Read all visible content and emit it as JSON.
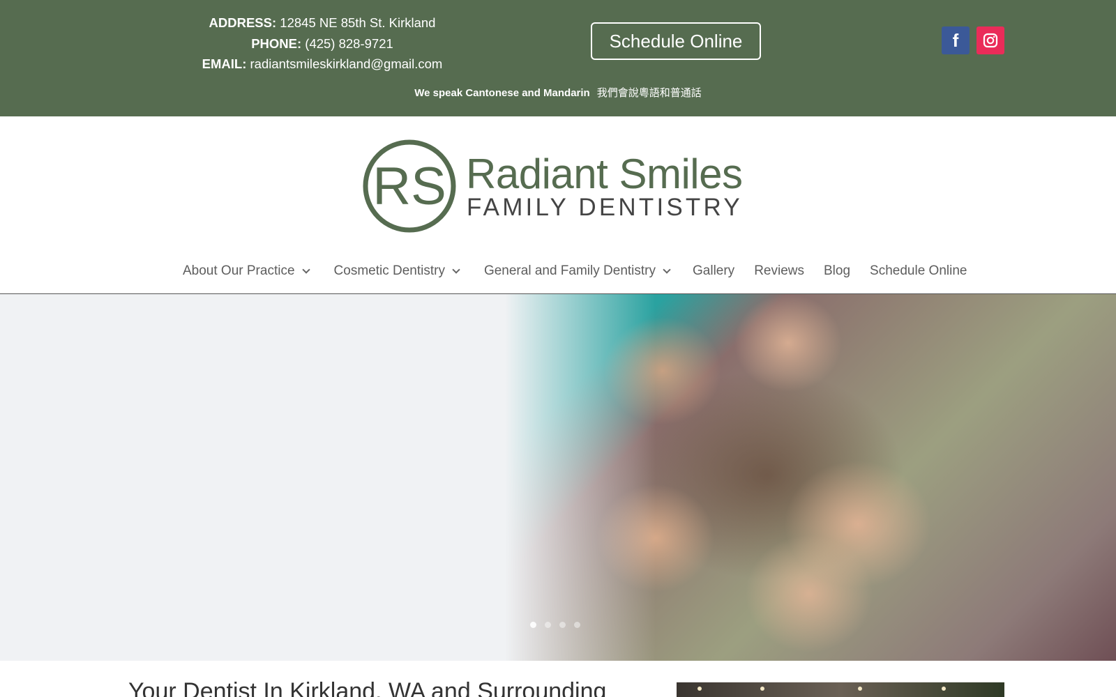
{
  "topbar": {
    "address_label": "ADDRESS:",
    "address": "12845 NE 85th St. Kirkland",
    "phone_label": "PHONE:",
    "phone": "(425) 828-9721",
    "email_label": "EMAIL:",
    "email": "radiantsmileskirkland@gmail.com",
    "schedule_button": "Schedule Online",
    "languages": "We speak Cantonese and Mandarin",
    "languages_cn": "我們會說粵語和普通話",
    "social": [
      {
        "icon": "facebook-icon",
        "color": "#3b5998"
      },
      {
        "icon": "instagram-icon",
        "color": "#ea2c59"
      }
    ],
    "background": "#566c50"
  },
  "logo": {
    "monogram": "RS",
    "name": "Radiant Smiles",
    "subtitle": "FAMILY DENTISTRY",
    "color": "#566c50"
  },
  "nav": {
    "items": [
      {
        "label": "About Our Practice",
        "has_dropdown": true
      },
      {
        "label": "Cosmetic Dentistry",
        "has_dropdown": true
      },
      {
        "label": "General and Family Dentistry",
        "has_dropdown": true
      },
      {
        "label": "Gallery",
        "has_dropdown": false
      },
      {
        "label": "Reviews",
        "has_dropdown": false
      },
      {
        "label": "Blog",
        "has_dropdown": false
      },
      {
        "label": "Schedule Online",
        "has_dropdown": false
      }
    ]
  },
  "hero": {
    "slide_count": 4,
    "active_slide": 1
  },
  "main": {
    "headline": "Your Dentist In Kirkland, WA and Surrounding"
  }
}
